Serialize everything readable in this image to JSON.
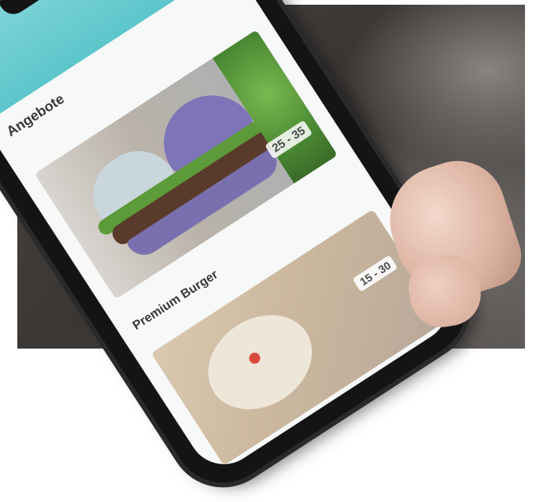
{
  "app": {
    "status_time": "",
    "carrier": "",
    "title": ""
  },
  "section1": {
    "title": "Angebote",
    "filters": [
      "",
      "",
      ""
    ],
    "meta": "",
    "time_badge": "25 - 35"
  },
  "section2": {
    "row_meta": "",
    "title": "Premium Burger",
    "subtitle": "",
    "time_badge": "15 - 30"
  },
  "colors": {
    "accent": "#5cc6cb",
    "background": "#3a3735"
  }
}
